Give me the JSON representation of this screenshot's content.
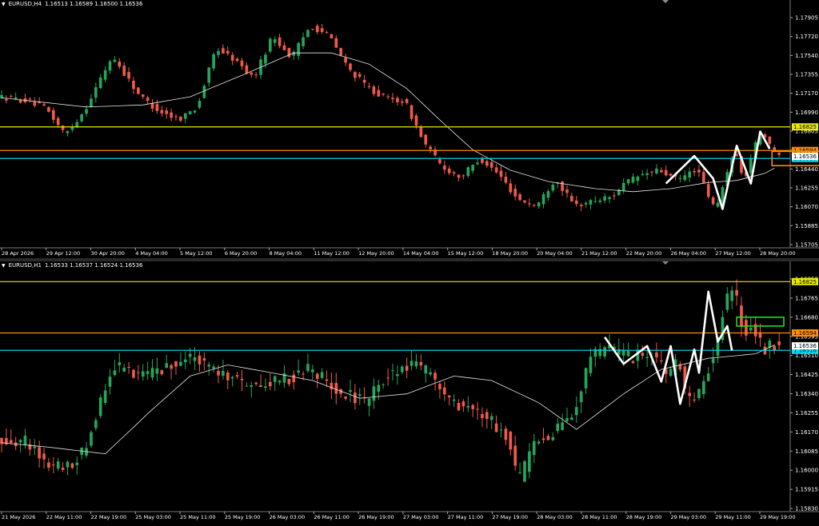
{
  "chart_data": [
    {
      "type": "candlestick",
      "symbol_label": "EURUSD,H4",
      "ohlc_label": "1.16513 1.16589 1.16500 1.16536",
      "ylim": [
        1.1564,
        1.1799
      ],
      "price_ticks": [
        "1.17905",
        "1.17720",
        "1.17540",
        "1.17355",
        "1.17170",
        "1.16990",
        "1.16805",
        "1.16625",
        "1.16440",
        "1.16255",
        "1.16070",
        "1.15885",
        "1.15705"
      ],
      "time_ticks": [
        "28 Apr 2026",
        "29 Apr 12:00",
        "30 Apr 20:00",
        "4 May 04:00",
        "5 May 12:00",
        "6 May 20:00",
        "8 May 04:00",
        "11 May 12:00",
        "12 May 20:00",
        "14 May 04:00",
        "15 May 12:00",
        "18 May 20:00",
        "20 May 04:00",
        "21 May 12:00",
        "22 May 20:00",
        "26 May 04:00",
        "27 May 12:00",
        "28 May 20:00"
      ],
      "levels": [
        {
          "price": 1.16825,
          "label": "1.16825",
          "color": "#e8e800"
        },
        {
          "price": 1.16594,
          "label": "1.16594",
          "color": "#ff8c00"
        },
        {
          "price": 1.16516,
          "label": "1.16516",
          "color": "#00e5ff"
        }
      ],
      "current_price": "1.16536",
      "moving_average": [
        [
          0,
          1.1711
        ],
        [
          8,
          1.1707
        ],
        [
          18,
          1.1702
        ],
        [
          30,
          1.1704
        ],
        [
          40,
          1.1712
        ],
        [
          52,
          1.1735
        ],
        [
          62,
          1.1755
        ],
        [
          70,
          1.1755
        ],
        [
          78,
          1.1744
        ],
        [
          86,
          1.172
        ],
        [
          94,
          1.1685
        ],
        [
          100,
          1.166
        ],
        [
          108,
          1.164
        ],
        [
          116,
          1.1629
        ],
        [
          126,
          1.1622
        ],
        [
          134,
          1.1619
        ],
        [
          142,
          1.1622
        ],
        [
          150,
          1.1628
        ],
        [
          156,
          1.163
        ],
        [
          162,
          1.1637
        ],
        [
          164,
          1.1642
        ]
      ],
      "waypoints": [
        [
          0,
          1.1712
        ],
        [
          6,
          1.1708
        ],
        [
          10,
          1.17
        ],
        [
          14,
          1.1675
        ],
        [
          18,
          1.1698
        ],
        [
          24,
          1.1752
        ],
        [
          28,
          1.1725
        ],
        [
          30,
          1.1712
        ],
        [
          34,
          1.1698
        ],
        [
          38,
          1.169
        ],
        [
          42,
          1.1702
        ],
        [
          46,
          1.176
        ],
        [
          50,
          1.1748
        ],
        [
          54,
          1.173
        ],
        [
          58,
          1.1772
        ],
        [
          62,
          1.175
        ],
        [
          66,
          1.1782
        ],
        [
          70,
          1.1772
        ],
        [
          74,
          1.174
        ],
        [
          78,
          1.1722
        ],
        [
          82,
          1.171
        ],
        [
          86,
          1.1708
        ],
        [
          90,
          1.1668
        ],
        [
          94,
          1.1643
        ],
        [
          98,
          1.1633
        ],
        [
          102,
          1.1652
        ],
        [
          106,
          1.1636
        ],
        [
          110,
          1.1612
        ],
        [
          114,
          1.1605
        ],
        [
          118,
          1.1632
        ],
        [
          122,
          1.1605
        ],
        [
          126,
          1.161
        ],
        [
          130,
          1.1614
        ],
        [
          132,
          1.1625
        ],
        [
          136,
          1.1635
        ],
        [
          140,
          1.164
        ],
        [
          144,
          1.163
        ],
        [
          148,
          1.1642
        ],
        [
          150,
          1.162
        ],
        [
          152,
          1.16
        ],
        [
          154,
          1.163
        ],
        [
          156,
          1.1662
        ],
        [
          158,
          1.1628
        ],
        [
          160,
          1.166
        ],
        [
          162,
          1.168
        ],
        [
          164,
          1.1658
        ]
      ],
      "pattern": [
        [
          141,
          1.1627
        ],
        [
          147,
          1.1654
        ],
        [
          151,
          1.1632
        ],
        [
          153,
          1.1602
        ],
        [
          156,
          1.1664
        ],
        [
          159,
          1.1627
        ],
        [
          161,
          1.1678
        ],
        [
          163,
          1.1661
        ]
      ],
      "target_box": {
        "x0": 163.5,
        "x1": 174,
        "p0": 1.16585,
        "p1": 1.16445,
        "color": "#ff8c00"
      }
    },
    {
      "type": "candlestick",
      "symbol_label": "EURUSD,H1",
      "ohlc_label": "1.16533 1.16537 1.16524 1.16536",
      "ylim": [
        1.1579,
        1.1688
      ],
      "price_ticks": [
        "1.16850",
        "1.16765",
        "1.16680",
        "1.16595",
        "1.16510",
        "1.16425",
        "1.16340",
        "1.16255",
        "1.16170",
        "1.16085",
        "1.16000",
        "1.15915",
        "1.15830"
      ],
      "time_ticks": [
        "21 May 2026",
        "22 May 11:00",
        "22 May 19:00",
        "25 May 03:00",
        "25 May 11:00",
        "25 May 19:00",
        "26 May 03:00",
        "26 May 11:00",
        "26 May 19:00",
        "27 May 03:00",
        "27 May 11:00",
        "27 May 19:00",
        "28 May 03:00",
        "28 May 11:00",
        "28 May 19:00",
        "29 May 03:00",
        "29 May 11:00",
        "29 May 19:00"
      ],
      "levels": [
        {
          "price": 1.16825,
          "label": "1.16825",
          "color": "#e8e800"
        },
        {
          "price": 1.16594,
          "label": "1.16594",
          "color": "#ff8c00"
        },
        {
          "price": 1.16516,
          "label": "1.16516",
          "color": "#00e5ff"
        }
      ],
      "current_price": "1.16536",
      "moving_average": [
        [
          0,
          1.161
        ],
        [
          10,
          1.1608
        ],
        [
          22,
          1.1605
        ],
        [
          32,
          1.1625
        ],
        [
          40,
          1.164
        ],
        [
          48,
          1.1645
        ],
        [
          56,
          1.1642
        ],
        [
          66,
          1.1638
        ],
        [
          76,
          1.163
        ],
        [
          86,
          1.1632
        ],
        [
          96,
          1.164
        ],
        [
          104,
          1.1638
        ],
        [
          114,
          1.1628
        ],
        [
          122,
          1.1616
        ],
        [
          132,
          1.1632
        ],
        [
          140,
          1.1643
        ],
        [
          150,
          1.1648
        ],
        [
          160,
          1.165
        ],
        [
          164,
          1.1654
        ]
      ],
      "waypoints": [
        [
          0,
          1.1612
        ],
        [
          6,
          1.161
        ],
        [
          10,
          1.16
        ],
        [
          14,
          1.1598
        ],
        [
          18,
          1.1607
        ],
        [
          24,
          1.1645
        ],
        [
          30,
          1.164
        ],
        [
          36,
          1.1645
        ],
        [
          42,
          1.1648
        ],
        [
          48,
          1.164
        ],
        [
          54,
          1.1635
        ],
        [
          60,
          1.1638
        ],
        [
          66,
          1.1643
        ],
        [
          72,
          1.1633
        ],
        [
          78,
          1.1628
        ],
        [
          82,
          1.164
        ],
        [
          88,
          1.1645
        ],
        [
          92,
          1.164
        ],
        [
          96,
          1.1628
        ],
        [
          100,
          1.1625
        ],
        [
          104,
          1.162
        ],
        [
          108,
          1.1612
        ],
        [
          110,
          1.1592
        ],
        [
          114,
          1.161
        ],
        [
          118,
          1.1615
        ],
        [
          122,
          1.1625
        ],
        [
          126,
          1.165
        ],
        [
          130,
          1.1652
        ],
        [
          134,
          1.1648
        ],
        [
          138,
          1.165
        ],
        [
          142,
          1.164
        ],
        [
          144,
          1.1648
        ],
        [
          146,
          1.1628
        ],
        [
          148,
          1.163
        ],
        [
          150,
          1.1642
        ],
        [
          152,
          1.165
        ],
        [
          154,
          1.1675
        ],
        [
          156,
          1.1678
        ],
        [
          158,
          1.166
        ],
        [
          160,
          1.1662
        ],
        [
          162,
          1.1652
        ],
        [
          164,
          1.1654
        ]
      ],
      "pattern": [
        [
          128,
          1.16575
        ],
        [
          132,
          1.16455
        ],
        [
          137,
          1.16535
        ],
        [
          140,
          1.16375
        ],
        [
          142,
          1.16535
        ],
        [
          144,
          1.16275
        ],
        [
          147,
          1.1652
        ],
        [
          148,
          1.16415
        ],
        [
          150,
          1.1678
        ],
        [
          152,
          1.16555
        ],
        [
          154,
          1.16625
        ],
        [
          155,
          1.16515
        ]
      ],
      "target_box": {
        "x0": 156,
        "x1": 166,
        "p0": 1.16665,
        "p1": 1.16625,
        "color": "#22dd22"
      }
    }
  ]
}
